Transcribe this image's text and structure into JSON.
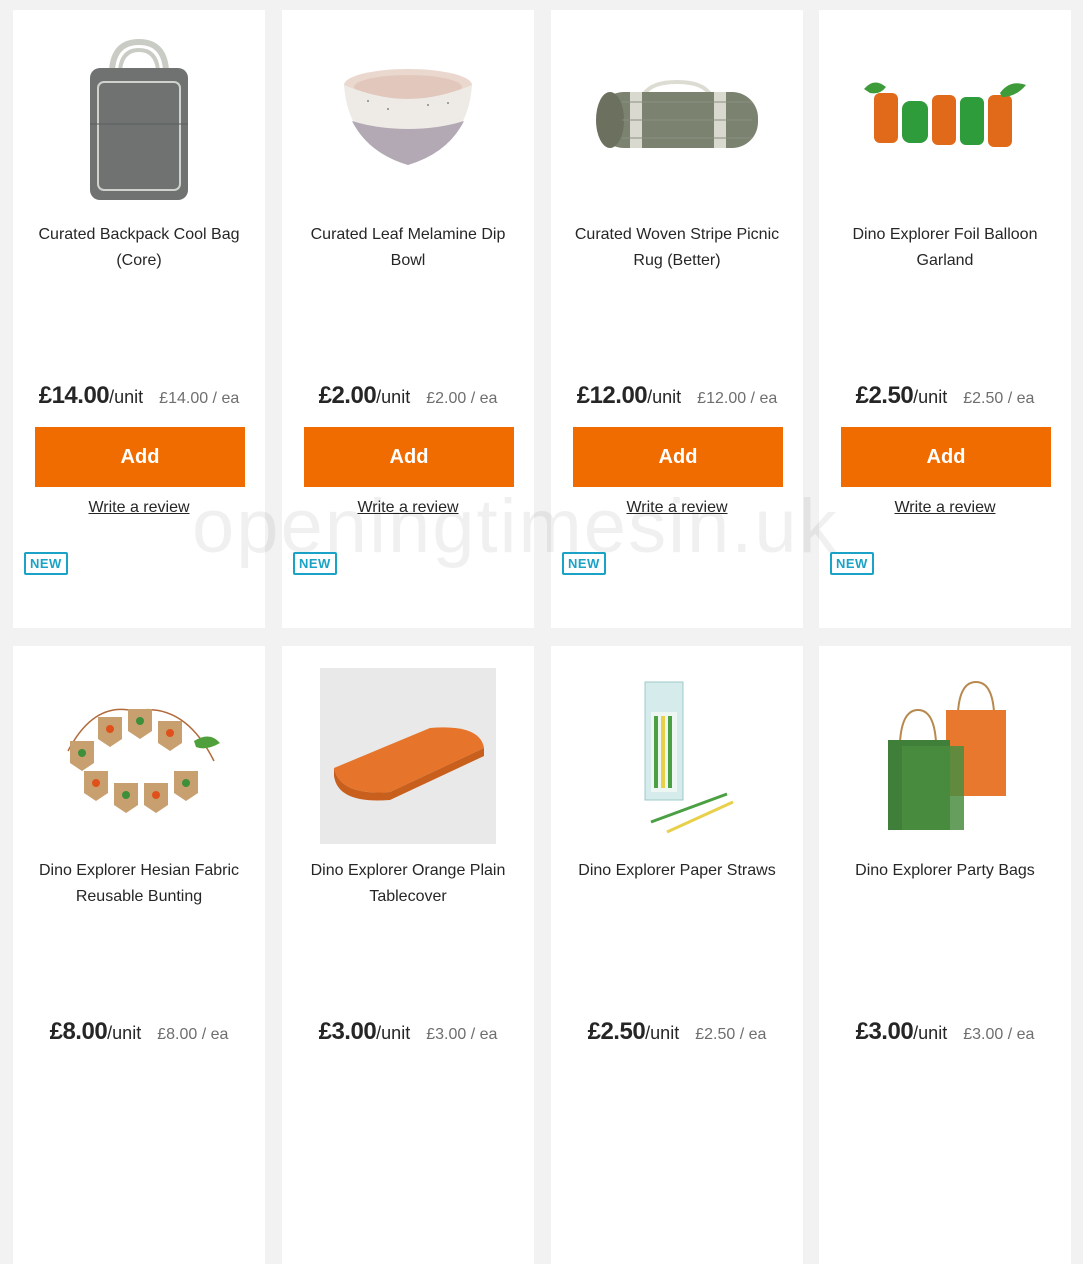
{
  "products": [
    {
      "title": "Curated Backpack Cool Bag (Core)",
      "price": "£14.00",
      "unit": "/unit",
      "per_unit": "£14.00 / ea",
      "add_label": "Add",
      "review_label": "Write a review",
      "badge": "NEW",
      "image_icon": "backpack-cool-bag-image"
    },
    {
      "title": "Curated Leaf Melamine Dip Bowl",
      "price": "£2.00",
      "unit": "/unit",
      "per_unit": "£2.00 / ea",
      "add_label": "Add",
      "review_label": "Write a review",
      "badge": "NEW",
      "image_icon": "dip-bowl-image"
    },
    {
      "title": "Curated Woven Stripe Picnic Rug (Better)",
      "price": "£12.00",
      "unit": "/unit",
      "per_unit": "£12.00 / ea",
      "add_label": "Add",
      "review_label": "Write a review",
      "badge": "NEW",
      "image_icon": "picnic-rug-image"
    },
    {
      "title": "Dino Explorer Foil Balloon Garland",
      "price": "£2.50",
      "unit": "/unit",
      "per_unit": "£2.50 / ea",
      "add_label": "Add",
      "review_label": "Write a review",
      "badge": "NEW",
      "image_icon": "balloon-garland-image"
    },
    {
      "title": "Dino Explorer Hesian Fabric Reusable Bunting",
      "price": "£8.00",
      "unit": "/unit",
      "per_unit": "£8.00 / ea",
      "image_icon": "bunting-image"
    },
    {
      "title": "Dino Explorer Orange Plain Tablecover",
      "price": "£3.00",
      "unit": "/unit",
      "per_unit": "£3.00 / ea",
      "image_icon": "tablecover-image"
    },
    {
      "title": "Dino Explorer Paper Straws",
      "price": "£2.50",
      "unit": "/unit",
      "per_unit": "£2.50 / ea",
      "image_icon": "paper-straws-image"
    },
    {
      "title": "Dino Explorer Party Bags",
      "price": "£3.00",
      "unit": "/unit",
      "per_unit": "£3.00 / ea",
      "image_icon": "party-bags-image"
    }
  ],
  "watermark": "openingtimesin.uk",
  "colors": {
    "add_button": "#f06c00",
    "badge": "#1ba3c7",
    "page_bg": "#f2f2f2"
  }
}
